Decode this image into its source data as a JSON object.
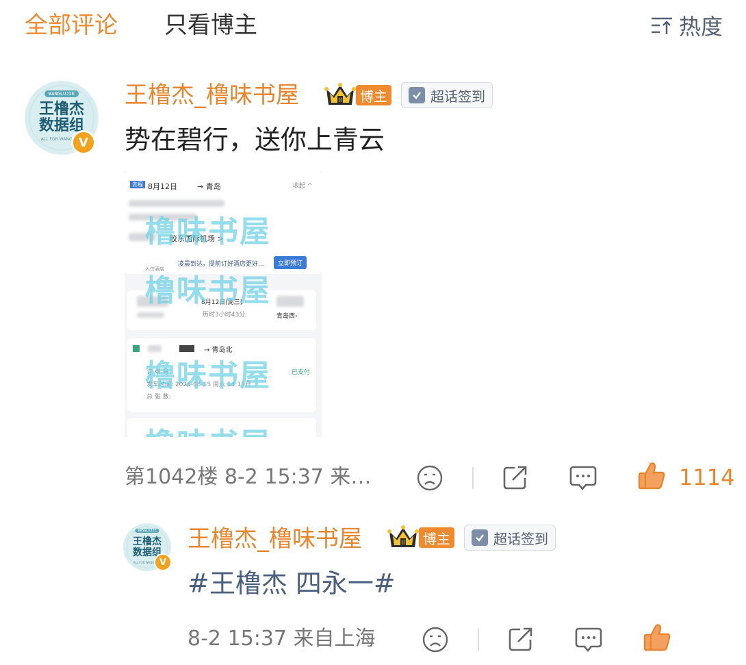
{
  "tabs": {
    "all": "全部评论",
    "blogger_only": "只看博主",
    "sort_label": "热度"
  },
  "comment": {
    "username": "王橹杰_橹味书屋",
    "blogger_tag": "博主",
    "topic_badge": "超话签到",
    "text": "势在碧行，送你上青云",
    "avatar": {
      "tag": "WANGLUJIE",
      "line1": "王橹杰",
      "line2": "数据组",
      "sub": "ALL FOR WANGLUJIE",
      "badge": "V"
    },
    "image": {
      "watermark": "橹味书屋",
      "trip_tag": "去程",
      "trip_date": "8月12日",
      "trip_to": "→ 青岛",
      "collapse": "收起 ^",
      "airport": "胶东国际机场 >",
      "hotel_tip": "凌晨到达，提前订好酒店更好...",
      "book_button": "立即预订",
      "hotel_icon_label": "入住酒店",
      "train_date": "8月12日(周三)",
      "duration": "历时3小时43分",
      "arrive_station": "青岛西›",
      "ticket_route": "→ 青岛北",
      "order_label": "订 单 号",
      "paid": "已支付",
      "depart_time": "发车时间: 2026-08-15 周六 14:11开",
      "ticket_count": "总 张 数:"
    },
    "floor_time_source": "第1042楼 8-2 15:37 来…",
    "like_count": "1114"
  },
  "reply": {
    "username": "王橹杰_橹味书屋",
    "blogger_tag": "博主",
    "topic_badge": "超话签到",
    "text": "#王橹杰 四永一#",
    "meta": "8-2 15:37 来自上海",
    "like_count": "",
    "avatar": {
      "tag": "WANGLUJIE",
      "line1": "王橹杰",
      "line2": "数据组",
      "sub": "ALL FOR WANGLUJIE",
      "badge": "V"
    }
  },
  "colors": {
    "accent": "#f08a2e",
    "hashtag": "#4a5f80",
    "meta": "#777777"
  },
  "icons": [
    "sort-icon",
    "crown-icon",
    "check-icon",
    "sad-face-icon",
    "share-icon",
    "comment-icon",
    "like-icon"
  ]
}
